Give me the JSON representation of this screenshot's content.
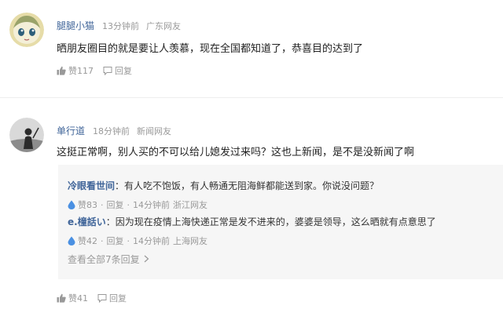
{
  "comments": [
    {
      "username": "腿腿小猫",
      "time": "13分钟前",
      "location": "广东网友",
      "text": "晒朋友圈目的就是要让人羡慕，现在全国都知道了，恭喜目的达到了",
      "like_label": "赞117",
      "reply_label": "回复",
      "avatar_icon": "cartoon-girl-avatar"
    },
    {
      "username": "单行道",
      "time": "18分钟前",
      "location": "新闻网友",
      "text": "这挺正常啊，别人买的不可以给儿媳发过来吗？这也上新闻，是不是没新闻了啊",
      "like_label": "赞41",
      "reply_label": "回复",
      "avatar_icon": "silhouette-avatar",
      "replies": [
        {
          "username": "冷眼看世间",
          "text": "：有人吃不饱饭，有人畅通无阻海鲜都能送到家。你说没问题？",
          "like_label": "赞83",
          "reply_label": "回复",
          "time": "14分钟前",
          "location": "浙江网友"
        },
        {
          "username": "e.橦話い",
          "text": "：因为现在疫情上海快递正常是发不进来的，婆婆是领导，这么晒就有点意思了",
          "like_label": "赞42",
          "reply_label": "回复",
          "time": "14分钟前",
          "location": "上海网友"
        }
      ],
      "view_all": "查看全部7条回复"
    }
  ],
  "colors": {
    "username": "#406599",
    "meta": "#999999",
    "reply_bg": "#f6f6f6",
    "like_blue": "#4a90e2"
  },
  "icons": [
    "thumbs-up-icon",
    "chat-bubble-icon",
    "water-drop-icon",
    "chevron-right-icon"
  ]
}
